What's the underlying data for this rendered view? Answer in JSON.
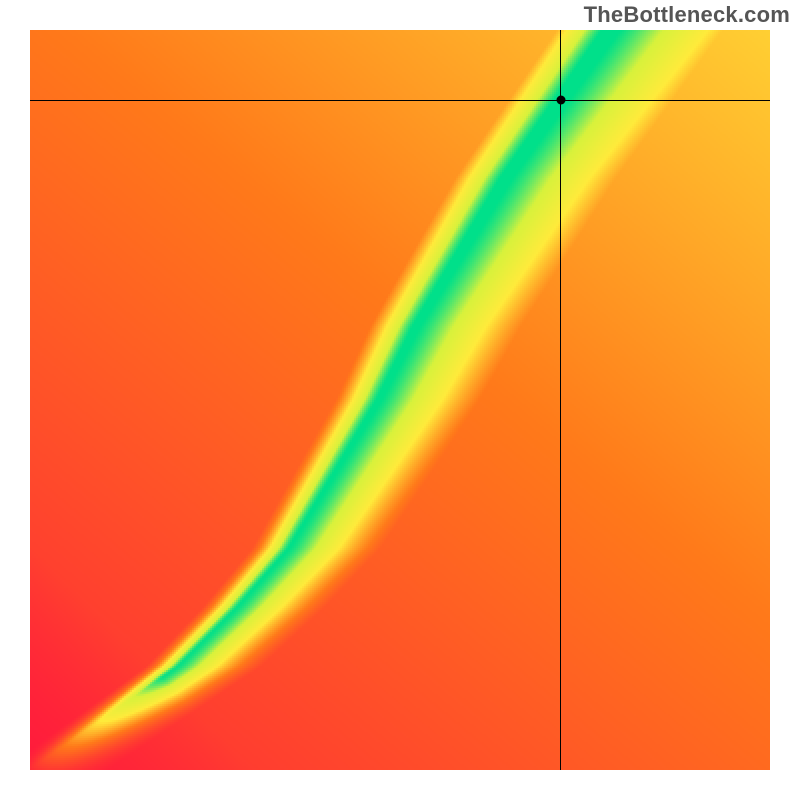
{
  "watermark": "TheBottleneck.com",
  "frame": {
    "outer_w": 800,
    "outer_h": 800,
    "inner_x": 30,
    "inner_y": 30,
    "inner_w": 740,
    "inner_h": 740
  },
  "colors": {
    "low": "#ff1a3d",
    "mid": "#ffeb3b",
    "high": "#00e08a",
    "marker": "#000000"
  },
  "chart_data": {
    "type": "heatmap",
    "title": "",
    "xlabel": "",
    "ylabel": "",
    "xlim": [
      0,
      1
    ],
    "ylim": [
      0,
      1
    ],
    "note": "Value is a fit score 0..1 (rendered red→yellow→green). Ridge of value≈1 follows a monotone curve from origin toward upper-right; field decays smoothly away from ridge. Cell values estimated from pixel colors at a coarse grid.",
    "grid": {
      "nx": 10,
      "ny": 10,
      "values": [
        [
          0.02,
          0.05,
          0.08,
          0.1,
          0.12,
          0.14,
          0.16,
          0.18,
          0.19,
          0.2
        ],
        [
          0.06,
          0.75,
          0.35,
          0.25,
          0.22,
          0.22,
          0.22,
          0.22,
          0.22,
          0.22
        ],
        [
          0.05,
          0.45,
          0.95,
          0.55,
          0.35,
          0.3,
          0.28,
          0.26,
          0.25,
          0.24
        ],
        [
          0.05,
          0.28,
          0.7,
          0.98,
          0.6,
          0.4,
          0.34,
          0.3,
          0.28,
          0.27
        ],
        [
          0.05,
          0.2,
          0.45,
          0.85,
          0.95,
          0.55,
          0.4,
          0.34,
          0.31,
          0.29
        ],
        [
          0.05,
          0.16,
          0.32,
          0.58,
          0.95,
          0.8,
          0.48,
          0.38,
          0.34,
          0.31
        ],
        [
          0.05,
          0.14,
          0.26,
          0.42,
          0.72,
          0.98,
          0.65,
          0.45,
          0.38,
          0.34
        ],
        [
          0.05,
          0.12,
          0.22,
          0.34,
          0.52,
          0.88,
          0.92,
          0.55,
          0.42,
          0.37
        ],
        [
          0.05,
          0.11,
          0.19,
          0.29,
          0.42,
          0.65,
          0.98,
          0.75,
          0.5,
          0.41
        ],
        [
          0.05,
          0.1,
          0.17,
          0.25,
          0.36,
          0.52,
          0.82,
          0.95,
          0.6,
          0.46
        ]
      ]
    },
    "ridge": {
      "description": "approx center of green band as (x_norm, y_norm) pairs, origin bottom-left",
      "points": [
        [
          0.0,
          0.0
        ],
        [
          0.1,
          0.07
        ],
        [
          0.2,
          0.14
        ],
        [
          0.28,
          0.22
        ],
        [
          0.35,
          0.3
        ],
        [
          0.41,
          0.4
        ],
        [
          0.47,
          0.5
        ],
        [
          0.52,
          0.6
        ],
        [
          0.58,
          0.7
        ],
        [
          0.64,
          0.8
        ],
        [
          0.71,
          0.9
        ],
        [
          0.78,
          1.0
        ]
      ],
      "half_width_norm_bottom": 0.015,
      "half_width_norm_top": 0.065
    },
    "marker": {
      "x_norm": 0.717,
      "y_norm": 0.905
    },
    "crosshair": {
      "x_norm": 0.717,
      "y_norm": 0.905
    }
  }
}
